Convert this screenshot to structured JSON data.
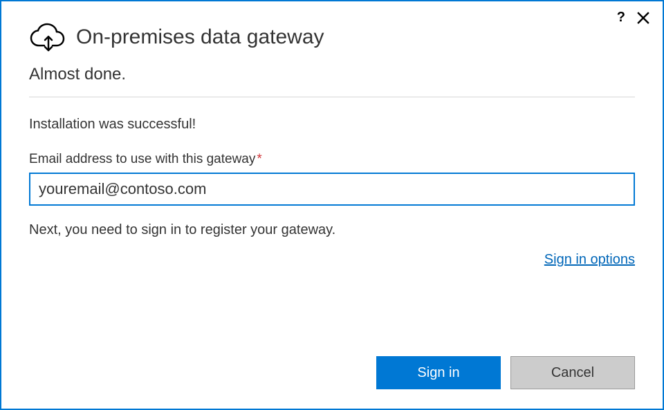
{
  "titlebar": {
    "help_symbol": "?"
  },
  "header": {
    "title": "On-premises data gateway"
  },
  "content": {
    "subheading": "Almost done.",
    "success": "Installation was successful!",
    "email_label": "Email address to use with this gateway",
    "required_mark": "*",
    "email_value": "youremail@contoso.com",
    "next_message": "Next, you need to sign in to register your gateway.",
    "sign_in_options": "Sign in options"
  },
  "buttons": {
    "primary": "Sign in",
    "cancel": "Cancel"
  }
}
